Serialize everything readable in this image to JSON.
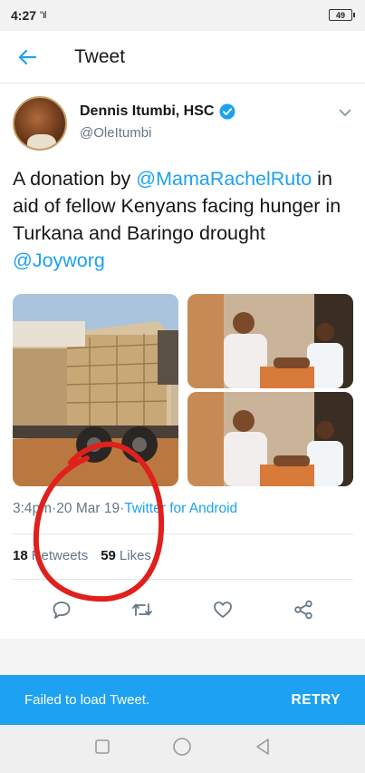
{
  "status_bar": {
    "time": "4:27",
    "signal": "\"ıl",
    "battery": "49"
  },
  "header": {
    "title": "Tweet"
  },
  "tweet": {
    "author_name": "Dennis Itumbi, HSC",
    "handle": "@OleItumbi",
    "text_parts": [
      "A donation by ",
      "@MamaRachelRuto",
      " in aid of fellow Kenyans facing hunger in Turkana and Baringo drought ",
      "@Joyworg"
    ],
    "time": "3:4",
    "time_suffix": " pm",
    "sep1": " · ",
    "date": "20 Mar 19",
    "sep2": " · ",
    "source": "Twitter for Android",
    "retweets_count": "18",
    "retweets_label": "Retweets",
    "likes_count": "59",
    "likes_label": "Likes"
  },
  "icons": {
    "back": "back-arrow-icon",
    "verified": "verified-badge-icon",
    "caret": "chevron-down-icon",
    "reply": "reply-icon",
    "retweet": "retweet-icon",
    "like": "heart-icon",
    "share": "share-icon"
  },
  "colors": {
    "accent": "#1da1f2",
    "annotation": "#e0201c"
  },
  "error_bar": {
    "message": "Failed to load Tweet.",
    "retry": "RETRY"
  }
}
